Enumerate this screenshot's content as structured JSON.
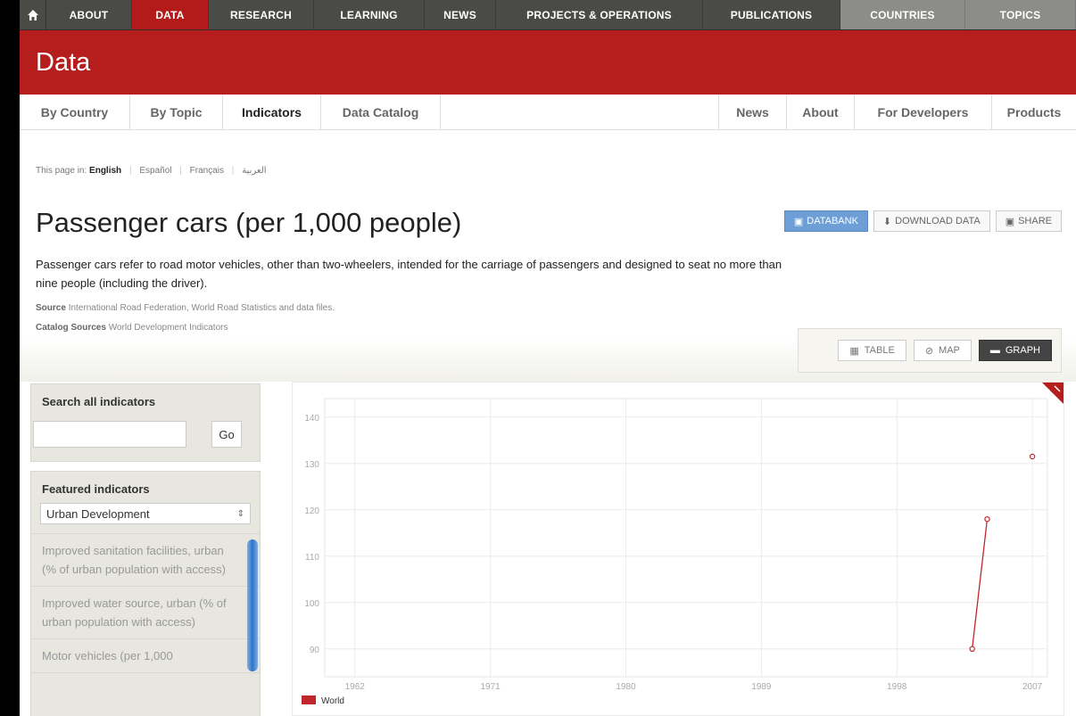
{
  "topnav": {
    "items": [
      {
        "label": "ABOUT",
        "state": "normal"
      },
      {
        "label": "DATA",
        "state": "active"
      },
      {
        "label": "RESEARCH",
        "state": "normal"
      },
      {
        "label": "LEARNING",
        "state": "normal"
      },
      {
        "label": "NEWS",
        "state": "normal"
      },
      {
        "label": "PROJECTS & OPERATIONS",
        "state": "normal"
      },
      {
        "label": "PUBLICATIONS",
        "state": "normal"
      },
      {
        "label": "COUNTRIES",
        "state": "grey"
      },
      {
        "label": "TOPICS",
        "state": "grey"
      }
    ]
  },
  "banner": {
    "title": "Data"
  },
  "subnav": {
    "left": [
      "By Country",
      "By Topic",
      "Indicators",
      "Data Catalog"
    ],
    "right": [
      "News",
      "About",
      "For Developers",
      "Products"
    ],
    "active": "Indicators"
  },
  "language": {
    "prefix": "This page in:",
    "current": "English",
    "others": [
      "Español",
      "Français",
      "العربية"
    ]
  },
  "indicator": {
    "title": "Passenger cars (per 1,000 people)",
    "description": "Passenger cars refer to road motor vehicles, other than two-wheelers, intended for the carriage of passengers and designed to seat no more than nine people (including the driver).",
    "source_label": "Source",
    "source_text": "International Road Federation, World Road Statistics and data files.",
    "catalog_label": "Catalog Sources",
    "catalog_text": "World Development Indicators"
  },
  "actions": {
    "databank": "DATABANK",
    "download": "DOWNLOAD DATA",
    "share": "SHARE"
  },
  "views": {
    "table": "TABLE",
    "map": "MAP",
    "graph": "GRAPH",
    "active": "GRAPH"
  },
  "sidebar": {
    "search_title": "Search all indicators",
    "search_value": "",
    "go_label": "Go",
    "featured_title": "Featured indicators",
    "featured_selected": "Urban Development",
    "featured_items": [
      "Improved sanitation facilities, urban (% of urban population with access)",
      "Improved water source, urban (% of urban population with access)",
      "Motor vehicles (per 1,000"
    ]
  },
  "chart_data": {
    "type": "line",
    "x_ticks": [
      "1962",
      "1971",
      "1980",
      "1989",
      "1998",
      "2007"
    ],
    "y_ticks": [
      90,
      100,
      110,
      120,
      130,
      140
    ],
    "xlim": [
      1960,
      2008
    ],
    "ylim": [
      84,
      144
    ],
    "series": [
      {
        "name": "World",
        "color": "#c0272d",
        "points": [
          [
            2003,
            90
          ],
          [
            2004,
            118
          ],
          [
            2007,
            131.5
          ]
        ],
        "segments": [
          [
            [
              2003,
              90
            ],
            [
              2004,
              118
            ]
          ]
        ]
      }
    ],
    "legend_position": "bottom-left",
    "grid": true
  }
}
